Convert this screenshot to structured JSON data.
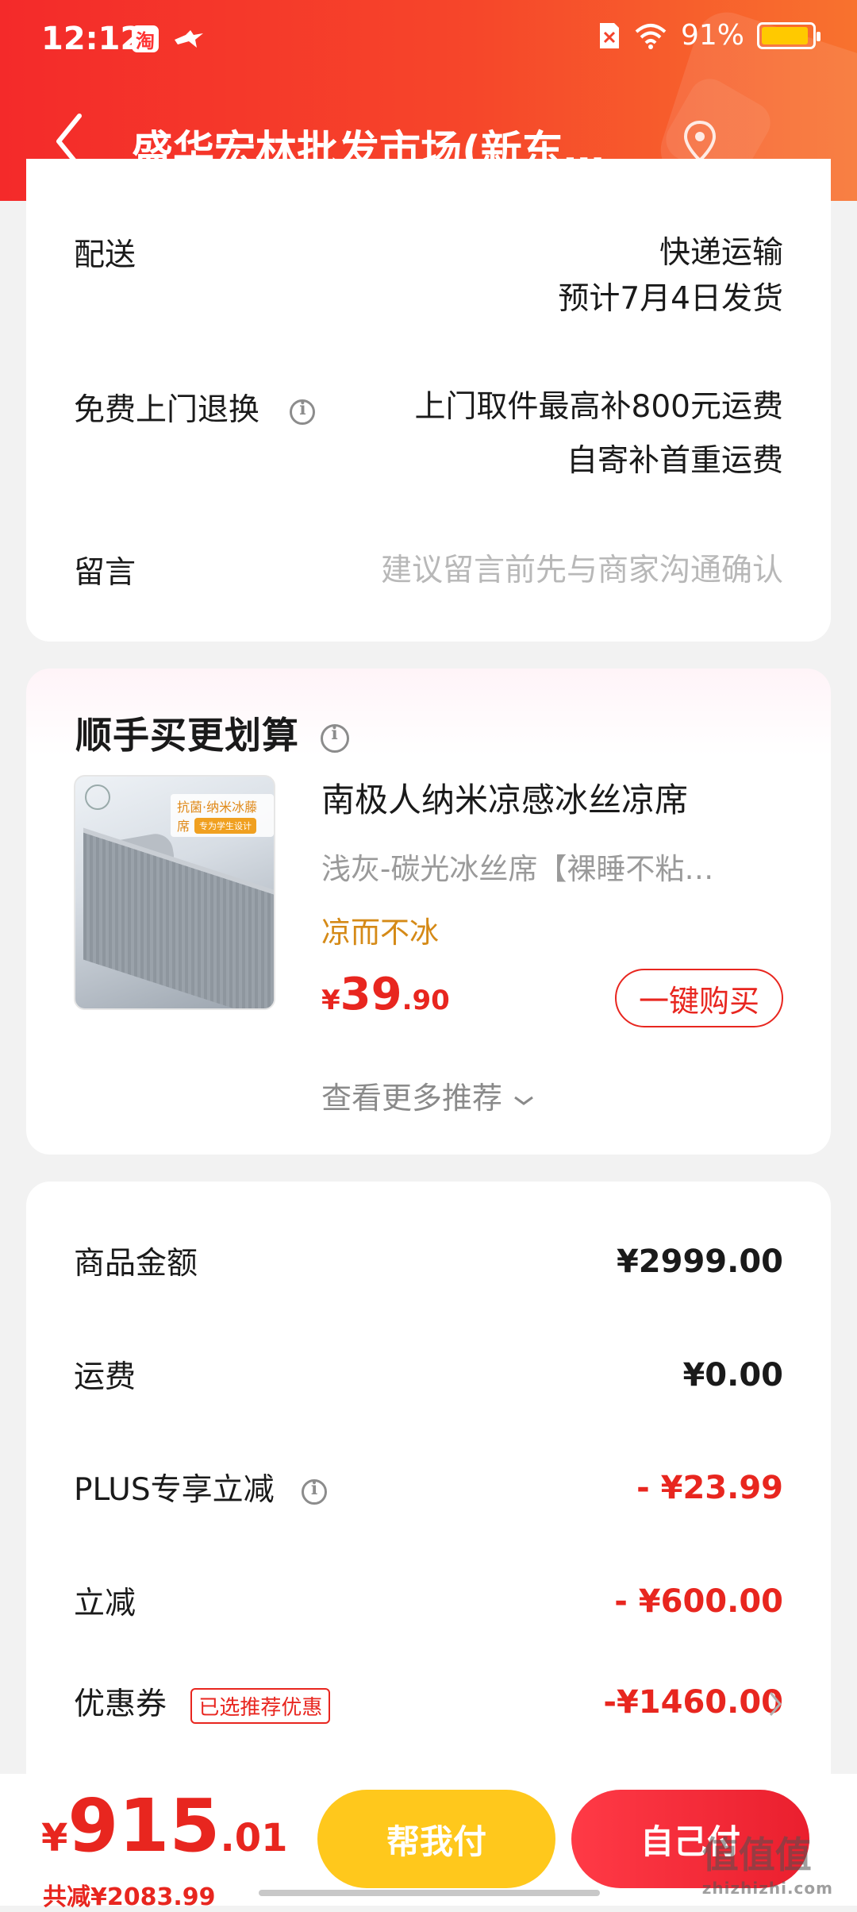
{
  "status_bar": {
    "time": "12:12",
    "app_icon_label": "淘",
    "battery": "91%",
    "battery_level": 0.91
  },
  "nav": {
    "title": "盛华宏林批发市场(新东…"
  },
  "delivery_card": {
    "shipping": {
      "label": "配送",
      "method": "快递运输",
      "eta": "预计7月4日发货"
    },
    "returns": {
      "label": "免费上门退换",
      "line1": "上门取件最高补800元运费",
      "line2": "自寄补首重运费"
    },
    "message": {
      "label": "留言",
      "placeholder": "建议留言前先与商家沟通确认"
    }
  },
  "recommend": {
    "title": "顺手买更划算",
    "product": {
      "name": "南极人纳米凉感冰丝凉席",
      "spec": "浅灰-碳光冰丝席【裸睡不粘…",
      "tag": "凉而不冰",
      "price_symbol": "¥",
      "price_int": "39",
      "price_dec": ".90",
      "buy_label": "一键购买",
      "image_tag": "抗菌·纳米冰藤席",
      "image_sub": "专为学生设计"
    },
    "more_label": "查看更多推荐"
  },
  "summary": {
    "goods": {
      "label": "商品金额",
      "value": "¥2999.00"
    },
    "freight": {
      "label": "运费",
      "value": "¥0.00"
    },
    "plus": {
      "label": "PLUS专享立减",
      "value": "- ¥23.99"
    },
    "discount": {
      "label": "立减",
      "value": "- ¥600.00"
    },
    "coupon": {
      "label": "优惠券",
      "chip": "已选推荐优惠",
      "value": "-¥1460.00"
    }
  },
  "bottom_bar": {
    "total_symbol": "¥",
    "total_int": "915",
    "total_dec": ".01",
    "saved": "共减¥2083.99",
    "help_pay": "帮我付",
    "self_pay": "自己付"
  },
  "watermark": {
    "main": "值值值",
    "sub": "zhizhizhi.com"
  },
  "colors": {
    "header_red": "#f42a2a",
    "price_red": "#e8261f",
    "tag_orange": "#d58a17",
    "help_yellow": "#ffc81c"
  }
}
